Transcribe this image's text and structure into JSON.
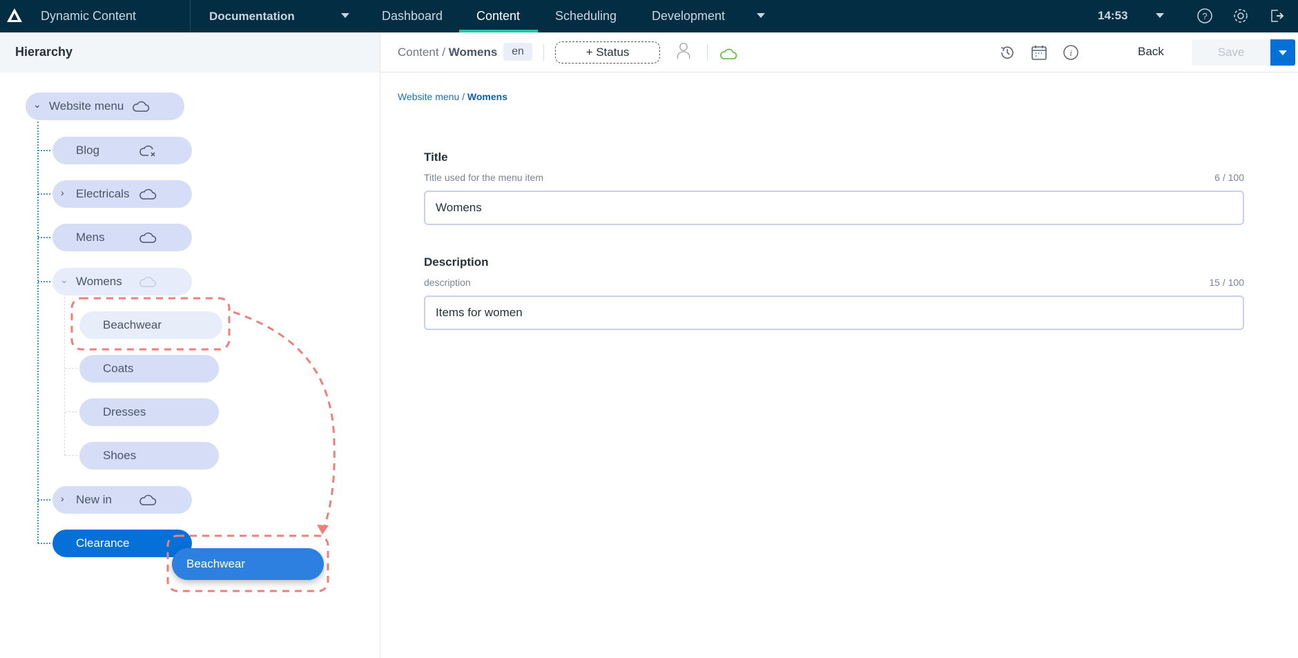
{
  "topbar": {
    "app_title": "Dynamic Content",
    "hub": "Documentation",
    "tabs": [
      {
        "label": "Dashboard",
        "active": false
      },
      {
        "label": "Content",
        "active": true
      },
      {
        "label": "Scheduling",
        "active": false
      },
      {
        "label": "Development",
        "active": false
      }
    ],
    "clock": "14:53",
    "accent": "#1ec5a2"
  },
  "hierarchy": {
    "title": "Hierarchy",
    "root": {
      "label": "Website menu",
      "expanded": true,
      "status": "cloud-icon"
    },
    "children": [
      {
        "label": "Blog",
        "status": "cloud-error-icon"
      },
      {
        "label": "Electricals",
        "collapsed": true,
        "status": "cloud-icon"
      },
      {
        "label": "Mens",
        "status": "cloud-icon"
      },
      {
        "label": "Womens",
        "expanded": true,
        "status": "cloud-icon",
        "selected": true
      },
      {
        "label": "New in",
        "collapsed": true,
        "status": "cloud-icon"
      },
      {
        "label": "Clearance",
        "highlighted": true
      }
    ],
    "womens_children": [
      "Beachwear",
      "Coats",
      "Dresses",
      "Shoes"
    ],
    "dragging": "Beachwear"
  },
  "content_header": {
    "crumb_root": "Content",
    "crumb_sep": "/",
    "crumb_current": "Womens",
    "locale": "en",
    "status_button": "+ Status",
    "back": "Back",
    "save": "Save"
  },
  "breadcrumb": {
    "parent": "Website menu",
    "sep": "/",
    "current": "Womens"
  },
  "fields": [
    {
      "label": "Title",
      "help": "Title used for the menu item",
      "count": "6 / 100",
      "value": "Womens"
    },
    {
      "label": "Description",
      "help": "description",
      "count": "15 / 100",
      "value": "Items for women"
    }
  ]
}
